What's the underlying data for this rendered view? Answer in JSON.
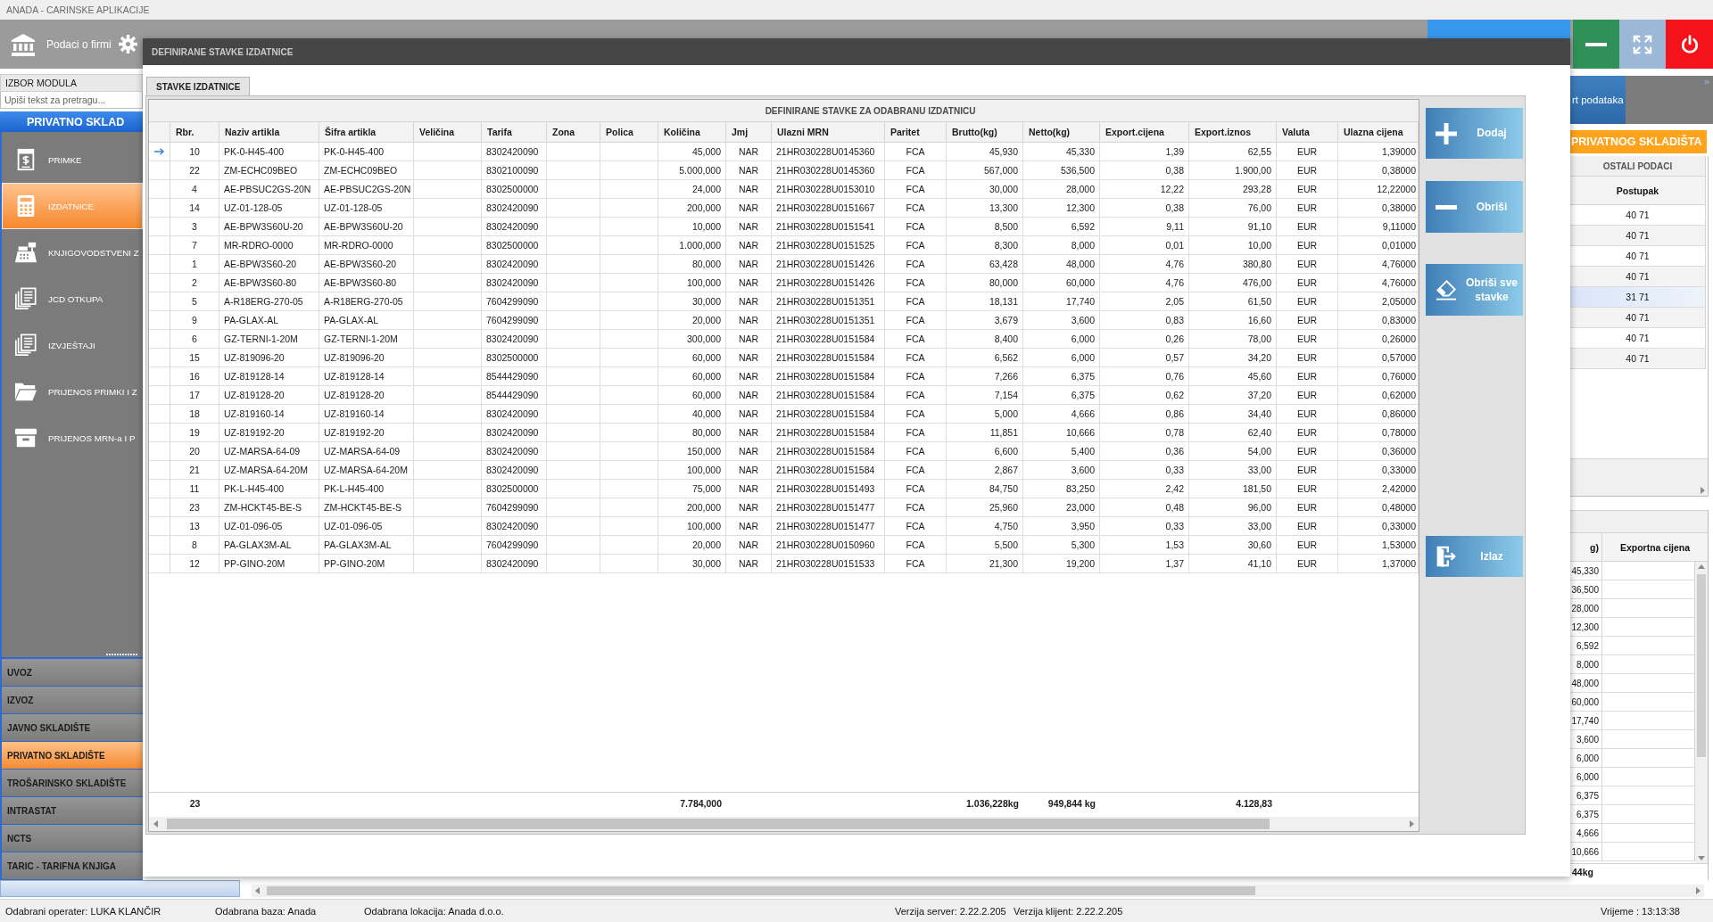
{
  "app": {
    "title": "ANADA - CARINSKE APLIKACIJE"
  },
  "toolbar": {
    "items": [
      {
        "kind": "bank",
        "label": "Podaci o firmi"
      },
      {
        "kind": "gear"
      }
    ],
    "window_buttons": [
      {
        "kind": "minimize"
      },
      {
        "kind": "maximize"
      },
      {
        "kind": "power"
      }
    ]
  },
  "sidebar": {
    "title": "IZBOR MODULA",
    "search": {
      "placeholder": "Upiši tekst za pretragu..."
    },
    "heading": "PRIVATNO SKLAD",
    "items": [
      {
        "label": "PRIMKE",
        "kind": "receipt",
        "selected": false
      },
      {
        "label": "IZDATNICE",
        "kind": "calculator",
        "selected": true
      },
      {
        "label": "KNJIGOVODSTVENI Z",
        "kind": "register",
        "selected": false
      },
      {
        "label": "JCD OTKUPA",
        "kind": "documents",
        "selected": false
      },
      {
        "label": "IZVJEŠTAJI",
        "kind": "documents",
        "selected": false
      },
      {
        "label": "PRIJENOS PRIMKI I Z",
        "kind": "folder",
        "selected": false
      },
      {
        "label": "PRIJENOS MRN-a I P",
        "kind": "drawer",
        "selected": false
      }
    ],
    "modules": [
      {
        "label": "UVOZ",
        "selected": false
      },
      {
        "label": "IZVOZ",
        "selected": false
      },
      {
        "label": "JAVNO SKLADIŠTE",
        "selected": false
      },
      {
        "label": "PRIVATNO SKLADIŠTE",
        "selected": true
      },
      {
        "label": "TROŠARINSKO SKLADIŠTE",
        "selected": false
      },
      {
        "label": "INTRASTAT",
        "selected": false
      },
      {
        "label": "NCTS",
        "selected": false
      },
      {
        "label": "TARIC - TARIFNA KNJIGA",
        "selected": false
      }
    ]
  },
  "dialog": {
    "title": "DEFINIRANE STAVKE IZDATNICE",
    "tabs": [
      {
        "label": "STAVKE IZDATNICE",
        "selected": true
      }
    ],
    "grid": {
      "caption": "DEFINIRANE STAVKE ZA ODABRANU IZDATNICU",
      "columns": [
        {
          "label": "Rbr.",
          "total": "23"
        },
        {
          "label": "Naziv artikla"
        },
        {
          "label": "Šifra artikla"
        },
        {
          "label": "Veličina"
        },
        {
          "label": "Tarifa"
        },
        {
          "label": "Zona"
        },
        {
          "label": "Polica"
        },
        {
          "label": "Količina",
          "total": "7.784,000"
        },
        {
          "label": "Jmj"
        },
        {
          "label": "Ulazni MRN"
        },
        {
          "label": "Paritet"
        },
        {
          "label": "Brutto(kg)",
          "total": "1.036,228kg"
        },
        {
          "label": "Netto(kg)",
          "total": "949,844 kg"
        },
        {
          "label": "Export.cijena"
        },
        {
          "label": "Export.iznos",
          "total": "4.128,83"
        },
        {
          "label": "Valuta"
        },
        {
          "label": "Ulazna cijena"
        }
      ],
      "rows": [
        {
          "current": true,
          "rbr": "10",
          "naziv": "PK-0-H45-400",
          "sifra": "PK-0-H45-400",
          "tarifa": "8302420090",
          "kolicina": "45,000",
          "jmj": "NAR",
          "mrn": "21HR030228U0145360",
          "paritet": "FCA",
          "brutto": "45,930",
          "netto": "45,330",
          "export_cijena": "1,39",
          "export_iznos": "62,55",
          "valuta": "EUR",
          "ulazna_cijena": "1,39000"
        },
        {
          "current": false,
          "rbr": "22",
          "naziv": "ZM-ECHC09BEO",
          "sifra": "ZM-ECHC09BEO",
          "tarifa": "8302100090",
          "kolicina": "5.000,000",
          "jmj": "NAR",
          "mrn": "21HR030228U0145360",
          "paritet": "FCA",
          "brutto": "567,000",
          "netto": "536,500",
          "export_cijena": "0,38",
          "export_iznos": "1.900,00",
          "valuta": "EUR",
          "ulazna_cijena": "0,38000"
        },
        {
          "current": false,
          "rbr": "4",
          "naziv": "AE-PBSUC2GS-20N",
          "sifra": "AE-PBSUC2GS-20N",
          "tarifa": "8302500000",
          "kolicina": "24,000",
          "jmj": "NAR",
          "mrn": "21HR030228U0153010",
          "paritet": "FCA",
          "brutto": "30,000",
          "netto": "28,000",
          "export_cijena": "12,22",
          "export_iznos": "293,28",
          "valuta": "EUR",
          "ulazna_cijena": "12,22000"
        },
        {
          "current": false,
          "rbr": "14",
          "naziv": "UZ-01-128-05",
          "sifra": "UZ-01-128-05",
          "tarifa": "8302420090",
          "kolicina": "200,000",
          "jmj": "NAR",
          "mrn": "21HR030228U0151667",
          "paritet": "FCA",
          "brutto": "13,300",
          "netto": "12,300",
          "export_cijena": "0,38",
          "export_iznos": "76,00",
          "valuta": "EUR",
          "ulazna_cijena": "0,38000"
        },
        {
          "current": false,
          "rbr": "3",
          "naziv": "AE-BPW3S60U-20",
          "sifra": "AE-BPW3S60U-20",
          "tarifa": "8302420090",
          "kolicina": "10,000",
          "jmj": "NAR",
          "mrn": "21HR030228U0151541",
          "paritet": "FCA",
          "brutto": "8,500",
          "netto": "6,592",
          "export_cijena": "9,11",
          "export_iznos": "91,10",
          "valuta": "EUR",
          "ulazna_cijena": "9,11000"
        },
        {
          "current": false,
          "rbr": "7",
          "naziv": "MR-RDRO-0000",
          "sifra": "MR-RDRO-0000",
          "tarifa": "8302500000",
          "kolicina": "1.000,000",
          "jmj": "NAR",
          "mrn": "21HR030228U0151525",
          "paritet": "FCA",
          "brutto": "8,300",
          "netto": "8,000",
          "export_cijena": "0,01",
          "export_iznos": "10,00",
          "valuta": "EUR",
          "ulazna_cijena": "0,01000"
        },
        {
          "current": false,
          "rbr": "1",
          "naziv": "AE-BPW3S60-20",
          "sifra": "AE-BPW3S60-20",
          "tarifa": "8302420090",
          "kolicina": "80,000",
          "jmj": "NAR",
          "mrn": "21HR030228U0151426",
          "paritet": "FCA",
          "brutto": "63,428",
          "netto": "48,000",
          "export_cijena": "4,76",
          "export_iznos": "380,80",
          "valuta": "EUR",
          "ulazna_cijena": "4,76000"
        },
        {
          "current": false,
          "rbr": "2",
          "naziv": "AE-BPW3S60-80",
          "sifra": "AE-BPW3S60-80",
          "tarifa": "8302420090",
          "kolicina": "100,000",
          "jmj": "NAR",
          "mrn": "21HR030228U0151426",
          "paritet": "FCA",
          "brutto": "80,000",
          "netto": "60,000",
          "export_cijena": "4,76",
          "export_iznos": "476,00",
          "valuta": "EUR",
          "ulazna_cijena": "4,76000"
        },
        {
          "current": false,
          "rbr": "5",
          "naziv": "A-R18ERG-270-05",
          "sifra": "A-R18ERG-270-05",
          "tarifa": "7604299090",
          "kolicina": "30,000",
          "jmj": "NAR",
          "mrn": "21HR030228U0151351",
          "paritet": "FCA",
          "brutto": "18,131",
          "netto": "17,740",
          "export_cijena": "2,05",
          "export_iznos": "61,50",
          "valuta": "EUR",
          "ulazna_cijena": "2,05000"
        },
        {
          "current": false,
          "rbr": "9",
          "naziv": "PA-GLAX-AL",
          "sifra": "PA-GLAX-AL",
          "tarifa": "7604299090",
          "kolicina": "20,000",
          "jmj": "NAR",
          "mrn": "21HR030228U0151351",
          "paritet": "FCA",
          "brutto": "3,679",
          "netto": "3,600",
          "export_cijena": "0,83",
          "export_iznos": "16,60",
          "valuta": "EUR",
          "ulazna_cijena": "0,83000"
        },
        {
          "current": false,
          "rbr": "6",
          "naziv": "GZ-TERNI-1-20M",
          "sifra": "GZ-TERNI-1-20M",
          "tarifa": "8302420090",
          "kolicina": "300,000",
          "jmj": "NAR",
          "mrn": "21HR030228U0151584",
          "paritet": "FCA",
          "brutto": "8,400",
          "netto": "6,000",
          "export_cijena": "0,26",
          "export_iznos": "78,00",
          "valuta": "EUR",
          "ulazna_cijena": "0,26000"
        },
        {
          "current": false,
          "rbr": "15",
          "naziv": "UZ-819096-20",
          "sifra": "UZ-819096-20",
          "tarifa": "8302500000",
          "kolicina": "60,000",
          "jmj": "NAR",
          "mrn": "21HR030228U0151584",
          "paritet": "FCA",
          "brutto": "6,562",
          "netto": "6,000",
          "export_cijena": "0,57",
          "export_iznos": "34,20",
          "valuta": "EUR",
          "ulazna_cijena": "0,57000"
        },
        {
          "current": false,
          "rbr": "16",
          "naziv": "UZ-819128-14",
          "sifra": "UZ-819128-14",
          "tarifa": "8544429090",
          "kolicina": "60,000",
          "jmj": "NAR",
          "mrn": "21HR030228U0151584",
          "paritet": "FCA",
          "brutto": "7,266",
          "netto": "6,375",
          "export_cijena": "0,76",
          "export_iznos": "45,60",
          "valuta": "EUR",
          "ulazna_cijena": "0,76000"
        },
        {
          "current": false,
          "rbr": "17",
          "naziv": "UZ-819128-20",
          "sifra": "UZ-819128-20",
          "tarifa": "8544429090",
          "kolicina": "60,000",
          "jmj": "NAR",
          "mrn": "21HR030228U0151584",
          "paritet": "FCA",
          "brutto": "7,154",
          "netto": "6,375",
          "export_cijena": "0,62",
          "export_iznos": "37,20",
          "valuta": "EUR",
          "ulazna_cijena": "0,62000"
        },
        {
          "current": false,
          "rbr": "18",
          "naziv": "UZ-819160-14",
          "sifra": "UZ-819160-14",
          "tarifa": "8302420090",
          "kolicina": "40,000",
          "jmj": "NAR",
          "mrn": "21HR030228U0151584",
          "paritet": "FCA",
          "brutto": "5,000",
          "netto": "4,666",
          "export_cijena": "0,86",
          "export_iznos": "34,40",
          "valuta": "EUR",
          "ulazna_cijena": "0,86000"
        },
        {
          "current": false,
          "rbr": "19",
          "naziv": "UZ-819192-20",
          "sifra": "UZ-819192-20",
          "tarifa": "8302420090",
          "kolicina": "80,000",
          "jmj": "NAR",
          "mrn": "21HR030228U0151584",
          "paritet": "FCA",
          "brutto": "11,851",
          "netto": "10,666",
          "export_cijena": "0,78",
          "export_iznos": "62,40",
          "valuta": "EUR",
          "ulazna_cijena": "0,78000"
        },
        {
          "current": false,
          "rbr": "20",
          "naziv": "UZ-MARSA-64-09",
          "sifra": "UZ-MARSA-64-09",
          "tarifa": "8302420090",
          "kolicina": "150,000",
          "jmj": "NAR",
          "mrn": "21HR030228U0151584",
          "paritet": "FCA",
          "brutto": "6,600",
          "netto": "5,400",
          "export_cijena": "0,36",
          "export_iznos": "54,00",
          "valuta": "EUR",
          "ulazna_cijena": "0,36000"
        },
        {
          "current": false,
          "rbr": "21",
          "naziv": "UZ-MARSA-64-20M",
          "sifra": "UZ-MARSA-64-20M",
          "tarifa": "8302420090",
          "kolicina": "100,000",
          "jmj": "NAR",
          "mrn": "21HR030228U0151584",
          "paritet": "FCA",
          "brutto": "2,867",
          "netto": "3,600",
          "export_cijena": "0,33",
          "export_iznos": "33,00",
          "valuta": "EUR",
          "ulazna_cijena": "0,33000"
        },
        {
          "current": false,
          "rbr": "11",
          "naziv": "PK-L-H45-400",
          "sifra": "PK-L-H45-400",
          "tarifa": "8302500000",
          "kolicina": "75,000",
          "jmj": "NAR",
          "mrn": "21HR030228U0151493",
          "paritet": "FCA",
          "brutto": "84,750",
          "netto": "83,250",
          "export_cijena": "2,42",
          "export_iznos": "181,50",
          "valuta": "EUR",
          "ulazna_cijena": "2,42000"
        },
        {
          "current": false,
          "rbr": "23",
          "naziv": "ZM-HCKT45-BE-S",
          "sifra": "ZM-HCKT45-BE-S",
          "tarifa": "7604299090",
          "kolicina": "200,000",
          "jmj": "NAR",
          "mrn": "21HR030228U0151477",
          "paritet": "FCA",
          "brutto": "25,960",
          "netto": "23,000",
          "export_cijena": "0,48",
          "export_iznos": "96,00",
          "valuta": "EUR",
          "ulazna_cijena": "0,48000"
        },
        {
          "current": false,
          "rbr": "13",
          "naziv": "UZ-01-096-05",
          "sifra": "UZ-01-096-05",
          "tarifa": "8302420090",
          "kolicina": "100,000",
          "jmj": "NAR",
          "mrn": "21HR030228U0151477",
          "paritet": "FCA",
          "brutto": "4,750",
          "netto": "3,950",
          "export_cijena": "0,33",
          "export_iznos": "33,00",
          "valuta": "EUR",
          "ulazna_cijena": "0,33000"
        },
        {
          "current": false,
          "rbr": "8",
          "naziv": "PA-GLAX3M-AL",
          "sifra": "PA-GLAX3M-AL",
          "tarifa": "7604299090",
          "kolicina": "20,000",
          "jmj": "NAR",
          "mrn": "21HR030228U0150960",
          "paritet": "FCA",
          "brutto": "5,500",
          "netto": "5,300",
          "export_cijena": "1,53",
          "export_iznos": "30,60",
          "valuta": "EUR",
          "ulazna_cijena": "1,53000"
        },
        {
          "current": false,
          "rbr": "12",
          "naziv": "PP-GINO-20M",
          "sifra": "PP-GINO-20M",
          "tarifa": "8302420090",
          "kolicina": "30,000",
          "jmj": "NAR",
          "mrn": "21HR030228U0151533",
          "paritet": "FCA",
          "brutto": "21,300",
          "netto": "19,200",
          "export_cijena": "1,37",
          "export_iznos": "41,10",
          "valuta": "EUR",
          "ulazna_cijena": "1,37000"
        }
      ]
    },
    "buttons": [
      {
        "label": "Dodaj",
        "kind": "add"
      },
      {
        "label": "Obriši",
        "kind": "remove"
      },
      {
        "label": "Obriši sve stavke",
        "kind": "erase"
      },
      {
        "label": "Izlaz",
        "kind": "exit"
      }
    ]
  },
  "right_panel": {
    "button": "rt podataka",
    "collapse": "»",
    "heading": "PRIVATNOG SKLADIŠTA",
    "upper_grid": {
      "caption": "OSTALI PODACI",
      "column": "Postupak",
      "rows": [
        {
          "value": "40 71",
          "selected": false
        },
        {
          "value": "40 71",
          "selected": false
        },
        {
          "value": "40 71",
          "selected": false
        },
        {
          "value": "40 71",
          "selected": false
        },
        {
          "value": "31 71",
          "selected": true
        },
        {
          "value": "40 71",
          "selected": false
        },
        {
          "value": "40 71",
          "selected": false
        },
        {
          "value": "40 71",
          "selected": false
        }
      ]
    },
    "lower_grid": {
      "columns": [
        "g)",
        "Exportna cijena"
      ],
      "rows": [
        "45,330",
        "36,500",
        "28,000",
        "12,300",
        "6,592",
        "8,000",
        "48,000",
        "60,000",
        "17,740",
        "3,600",
        "6,000",
        "6,000",
        "6,375",
        "6,375",
        "4,666",
        "10,666"
      ],
      "footer": "44kg"
    }
  },
  "status_bar": [
    "Odabrani operater: LUKA KLANČIR",
    "Odabrana baza: Anada",
    "Odabrana lokacija: Anada d.o.o.",
    "Verzija server: 2.22.2.205",
    "Verzija klijent: 2.22.2.205",
    "Vrijeme : 13:13:38"
  ]
}
